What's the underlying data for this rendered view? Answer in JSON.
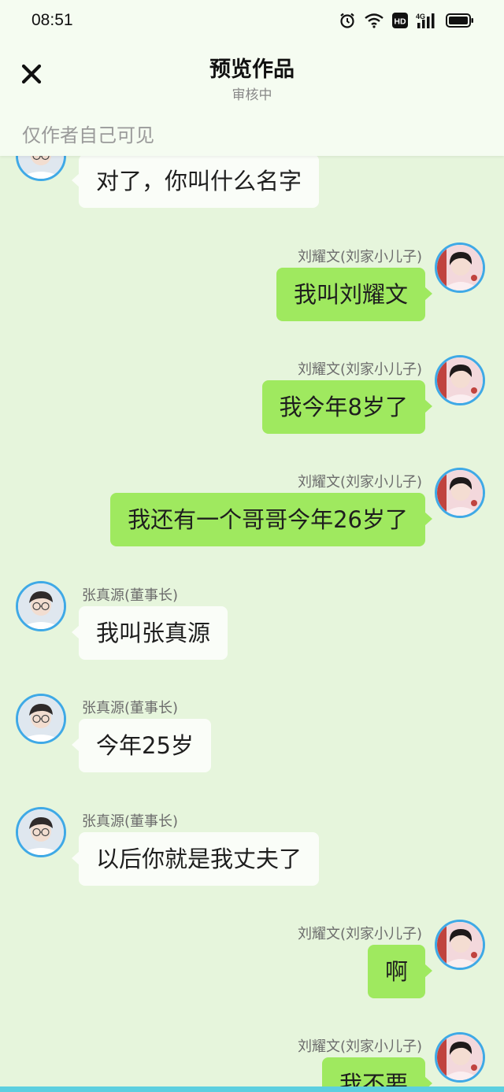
{
  "status_bar": {
    "time": "08:51",
    "icons": [
      "alarm-icon",
      "wifi-icon",
      "hd-icon",
      "signal-4g-icon",
      "battery-icon"
    ]
  },
  "header": {
    "title": "预览作品",
    "subtitle": "审核中",
    "close_icon": "close-icon"
  },
  "visibility": {
    "text": "仅作者自己可见"
  },
  "colors": {
    "background": "#e6f5dc",
    "bubble_left": "#fafdf8",
    "bubble_right": "#9fe95f",
    "avatar_border": "#3fa9e6"
  },
  "messages": [
    {
      "side": "left",
      "sender": "",
      "text": "对了，你叫什么名字"
    },
    {
      "side": "right",
      "sender": "刘耀文(刘家小儿子)",
      "text": "我叫刘耀文"
    },
    {
      "side": "right",
      "sender": "刘耀文(刘家小儿子)",
      "text": "我今年8岁了"
    },
    {
      "side": "right",
      "sender": "刘耀文(刘家小儿子)",
      "text": "我还有一个哥哥今年26岁了"
    },
    {
      "side": "left",
      "sender": "张真源(董事长)",
      "text": "我叫张真源"
    },
    {
      "side": "left",
      "sender": "张真源(董事长)",
      "text": "今年25岁"
    },
    {
      "side": "left",
      "sender": "张真源(董事长)",
      "text": "以后你就是我丈夫了"
    },
    {
      "side": "right",
      "sender": "刘耀文(刘家小儿子)",
      "text": "啊"
    },
    {
      "side": "right",
      "sender": "刘耀文(刘家小儿子)",
      "text": "我不要"
    }
  ]
}
